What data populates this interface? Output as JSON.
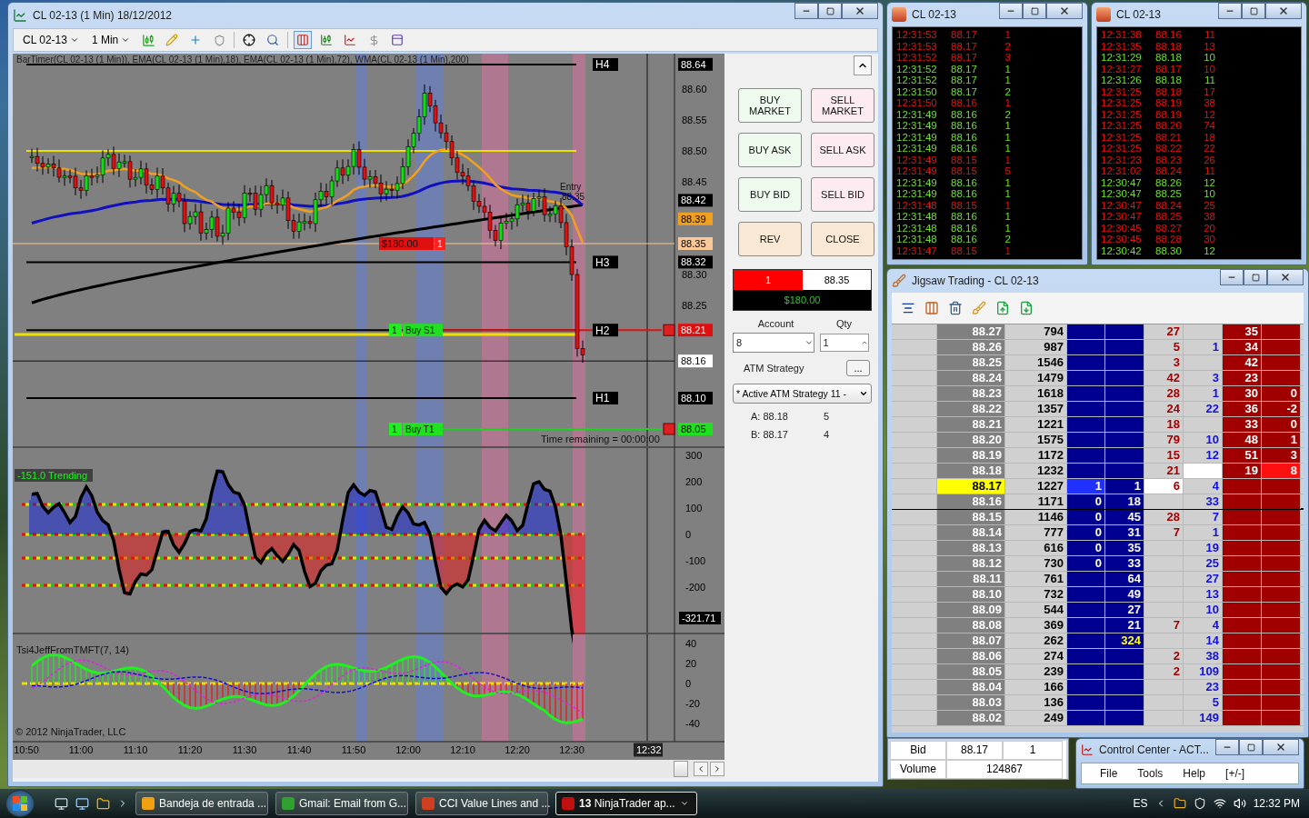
{
  "chart_window": {
    "title": "CL 02-13 (1 Min)  18/12/2012",
    "toolbar": {
      "instrument": "CL 02-13",
      "interval": "1 Min"
    },
    "chart": {
      "caption": "BarTimer(CL 02-13 (1 Min)), EMA(CL 02-13 (1 Min),18), EMA(CL 02-13 (1 Min),72), WMA(CL 02-13 (1 Min),200)",
      "price_axis": [
        {
          "text": "88.64",
          "kind": "boxed",
          "color": "#000000"
        },
        {
          "text": "88.60",
          "kind": "plain"
        },
        {
          "text": "88.55",
          "kind": "plain"
        },
        {
          "text": "88.50",
          "kind": "plain"
        },
        {
          "text": "88.45",
          "kind": "plain"
        },
        {
          "text": "88.42",
          "kind": "boxed",
          "color": "#000000"
        },
        {
          "text": "88.39",
          "kind": "boxed",
          "color": "#f0a020"
        },
        {
          "text": "88.35",
          "kind": "boxed",
          "color": "#f8c898"
        },
        {
          "text": "88.32",
          "kind": "boxed",
          "color": "#000000"
        },
        {
          "text": "88.30",
          "kind": "plain"
        },
        {
          "text": "88.25",
          "kind": "plain"
        },
        {
          "text": "88.21",
          "kind": "boxed",
          "color": "#e01010"
        },
        {
          "text": "88.16",
          "kind": "boxed",
          "color": "#ffffff"
        },
        {
          "text": "88.10",
          "kind": "boxed",
          "color": "#000000"
        },
        {
          "text": "88.05",
          "kind": "boxed",
          "color": "#20e020"
        }
      ],
      "levels": [
        {
          "label": "H4"
        },
        {
          "label": "H3"
        },
        {
          "label": "H2"
        },
        {
          "label": "H1"
        }
      ],
      "entry": {
        "label": "Entry",
        "price": "88.35"
      },
      "position": {
        "pnl": "$180.00",
        "qty": "1"
      },
      "orders": [
        {
          "qty": "1",
          "label": "Buy S1"
        },
        {
          "qty": "1",
          "label": "Buy T1"
        }
      ],
      "bar_timer": "Time remaining = 00:00:00",
      "oscillator": {
        "caption": "-151.0 Trending",
        "axis": [
          "300",
          "200",
          "100",
          "0",
          "-100",
          "-200"
        ],
        "value": "-321.71"
      },
      "tsi": {
        "caption": "Tsi4JeffFromTMFT(7, 14)",
        "axis": [
          "40",
          "20",
          "0",
          "-20",
          "-40"
        ]
      },
      "copyright": "© 2012 NinjaTrader, LLC",
      "time_axis": [
        "10:50",
        "11:00",
        "11:10",
        "11:20",
        "11:30",
        "11:40",
        "11:50",
        "12:00",
        "12:10",
        "12:20",
        "12:30"
      ],
      "cursor_time": "12:32"
    },
    "order_panel": {
      "buttons": [
        {
          "label": "BUY MARKET",
          "kind": "buy"
        },
        {
          "label": "SELL MARKET",
          "kind": "sell"
        },
        {
          "label": "BUY ASK",
          "kind": "buy"
        },
        {
          "label": "SELL ASK",
          "kind": "sell"
        },
        {
          "label": "BUY BID",
          "kind": "buy"
        },
        {
          "label": "SELL BID",
          "kind": "sell"
        },
        {
          "label": "REV",
          "kind": "neutral"
        },
        {
          "label": "CLOSE",
          "kind": "neutral"
        }
      ],
      "position": {
        "qty": "1",
        "avg_price": "88.35",
        "pnl": "$180.00"
      },
      "account_label": "Account",
      "account": "8",
      "qty_label": "Qty",
      "qty": "1",
      "atm_label": "ATM Strategy",
      "atm_button": "...",
      "atm_strategy": "* Active ATM Strategy 11 -",
      "quotes": [
        {
          "label": "A: 88.18",
          "size": "5"
        },
        {
          "label": "B: 88.17",
          "size": "4"
        }
      ]
    }
  },
  "time_and_sales": [
    {
      "title": "CL 02-13",
      "trades": [
        {
          "time": "12:31:53",
          "price": "88.17",
          "size": "1",
          "color": "#e81010"
        },
        {
          "time": "12:31:53",
          "price": "88.17",
          "size": "2",
          "color": "#e81010"
        },
        {
          "time": "12:31:52",
          "price": "88.17",
          "size": "3",
          "color": "#e81010"
        },
        {
          "time": "12:31:52",
          "price": "88.17",
          "size": "1",
          "color": "#70e020"
        },
        {
          "time": "12:31:52",
          "price": "88.17",
          "size": "1",
          "color": "#70e020"
        },
        {
          "time": "12:31:50",
          "price": "88.17",
          "size": "2",
          "color": "#70e020"
        },
        {
          "time": "12:31:50",
          "price": "88.16",
          "size": "1",
          "color": "#e81010"
        },
        {
          "time": "12:31:49",
          "price": "88.16",
          "size": "2",
          "color": "#70e020"
        },
        {
          "time": "12:31:49",
          "price": "88.16",
          "size": "1",
          "color": "#70e020"
        },
        {
          "time": "12:31:49",
          "price": "88.16",
          "size": "1",
          "color": "#70e020"
        },
        {
          "time": "12:31:49",
          "price": "88.16",
          "size": "1",
          "color": "#70e020"
        },
        {
          "time": "12:31:49",
          "price": "88.15",
          "size": "1",
          "color": "#e81010"
        },
        {
          "time": "12:31:49",
          "price": "88.15",
          "size": "5",
          "color": "#e81010"
        },
        {
          "time": "12:31:49",
          "price": "88.16",
          "size": "1",
          "color": "#70e020"
        },
        {
          "time": "12:31:49",
          "price": "88.16",
          "size": "1",
          "color": "#70e020"
        },
        {
          "time": "12:31:48",
          "price": "88.15",
          "size": "1",
          "color": "#e81010"
        },
        {
          "time": "12:31:48",
          "price": "88.16",
          "size": "1",
          "color": "#70e020"
        },
        {
          "time": "12:31:48",
          "price": "88.16",
          "size": "1",
          "color": "#70e020"
        },
        {
          "time": "12:31:48",
          "price": "88.16",
          "size": "2",
          "color": "#70e020"
        },
        {
          "time": "12:31:47",
          "price": "88.15",
          "size": "1",
          "color": "#e81010"
        }
      ]
    },
    {
      "title": "CL 02-13",
      "trades": [
        {
          "time": "12:31:38",
          "price": "88.16",
          "size": "11",
          "color": "#e81010"
        },
        {
          "time": "12:31:35",
          "price": "88.18",
          "size": "13",
          "color": "#e81010"
        },
        {
          "time": "12:31:29",
          "price": "88.18",
          "size": "10",
          "color": "#70e020"
        },
        {
          "time": "12:31:27",
          "price": "88.17",
          "size": "10",
          "color": "#e81010"
        },
        {
          "time": "12:31:26",
          "price": "88.18",
          "size": "11",
          "color": "#70e020"
        },
        {
          "time": "12:31:25",
          "price": "88.18",
          "size": "17",
          "color": "#e81010"
        },
        {
          "time": "12:31:25",
          "price": "88.19",
          "size": "38",
          "color": "#e81010"
        },
        {
          "time": "12:31:25",
          "price": "88.19",
          "size": "12",
          "color": "#e81010"
        },
        {
          "time": "12:31:25",
          "price": "88.20",
          "size": "74",
          "color": "#e81010"
        },
        {
          "time": "12:31:25",
          "price": "88.21",
          "size": "18",
          "color": "#e81010"
        },
        {
          "time": "12:31:25",
          "price": "88.22",
          "size": "22",
          "color": "#e81010"
        },
        {
          "time": "12:31:23",
          "price": "88.23",
          "size": "26",
          "color": "#e81010"
        },
        {
          "time": "12:31:02",
          "price": "88.24",
          "size": "11",
          "color": "#e81010"
        },
        {
          "time": "12:30:47",
          "price": "88.26",
          "size": "12",
          "color": "#70e020"
        },
        {
          "time": "12:30:47",
          "price": "88.25",
          "size": "10",
          "color": "#70e020"
        },
        {
          "time": "12:30:47",
          "price": "88.24",
          "size": "25",
          "color": "#e81010"
        },
        {
          "time": "12:30:47",
          "price": "88.25",
          "size": "38",
          "color": "#e81010"
        },
        {
          "time": "12:30:45",
          "price": "88.27",
          "size": "20",
          "color": "#e81010"
        },
        {
          "time": "12:30:45",
          "price": "88.28",
          "size": "30",
          "color": "#e81010"
        },
        {
          "time": "12:30:42",
          "price": "88.30",
          "size": "12",
          "color": "#70e020"
        }
      ]
    }
  ],
  "ladder_window": {
    "title": "Jigsaw Trading - CL 02-13",
    "rows": [
      {
        "price": "88.27",
        "volume": "794",
        "current": false,
        "split": false,
        "cells": [
          null,
          null,
          "27",
          null,
          "35",
          null
        ]
      },
      {
        "price": "88.26",
        "volume": "987",
        "current": false,
        "split": false,
        "cells": [
          null,
          null,
          "5",
          "1",
          "34",
          null
        ]
      },
      {
        "price": "88.25",
        "volume": "1546",
        "current": false,
        "split": false,
        "cells": [
          null,
          null,
          "3",
          null,
          "42",
          null
        ]
      },
      {
        "price": "88.24",
        "volume": "1479",
        "current": false,
        "split": false,
        "cells": [
          null,
          null,
          "42",
          "3",
          "23",
          null
        ]
      },
      {
        "price": "88.23",
        "volume": "1618",
        "current": false,
        "split": false,
        "cells": [
          null,
          null,
          "28",
          "1",
          "30",
          "0"
        ]
      },
      {
        "price": "88.22",
        "volume": "1357",
        "current": false,
        "split": false,
        "cells": [
          null,
          null,
          "24",
          "22",
          "36",
          "-2"
        ]
      },
      {
        "price": "88.21",
        "volume": "1221",
        "current": false,
        "split": false,
        "cells": [
          null,
          null,
          "18",
          null,
          "33",
          "0"
        ]
      },
      {
        "price": "88.20",
        "volume": "1575",
        "current": false,
        "split": false,
        "cells": [
          null,
          null,
          "79",
          "10",
          "48",
          "1"
        ]
      },
      {
        "price": "88.19",
        "volume": "1172",
        "current": false,
        "split": false,
        "cells": [
          null,
          null,
          "15",
          "12",
          "51",
          "3"
        ]
      },
      {
        "price": "88.18",
        "volume": "1232",
        "current": false,
        "split": false,
        "cells": [
          null,
          null,
          "21",
          {
            "highlight": true
          },
          "19",
          {
            "text": "8",
            "highlight": true
          }
        ]
      },
      {
        "price": "88.17",
        "volume": "1227",
        "current": true,
        "split": false,
        "cells": [
          {
            "text": "1",
            "highlight": true
          },
          "1",
          {
            "text": "6",
            "highlight": true
          },
          "4",
          null,
          null
        ]
      },
      {
        "price": "88.16",
        "volume": "1171",
        "current": false,
        "split": true,
        "cells": [
          "0",
          "18",
          null,
          "33",
          null,
          null
        ]
      },
      {
        "price": "88.15",
        "volume": "1146",
        "current": false,
        "split": false,
        "cells": [
          "0",
          "45",
          "28",
          "7",
          null,
          null
        ]
      },
      {
        "price": "88.14",
        "volume": "777",
        "current": false,
        "split": false,
        "cells": [
          "0",
          "31",
          "7",
          "1",
          null,
          null
        ]
      },
      {
        "price": "88.13",
        "volume": "616",
        "current": false,
        "split": false,
        "cells": [
          "0",
          "35",
          null,
          "19",
          null,
          null
        ]
      },
      {
        "price": "88.12",
        "volume": "730",
        "current": false,
        "split": false,
        "cells": [
          "0",
          "33",
          null,
          "25",
          null,
          null
        ]
      },
      {
        "price": "88.11",
        "volume": "761",
        "current": false,
        "split": false,
        "cells": [
          null,
          "64",
          null,
          "27",
          null,
          null
        ]
      },
      {
        "price": "88.10",
        "volume": "732",
        "current": false,
        "split": false,
        "cells": [
          null,
          "49",
          null,
          "13",
          null,
          null
        ]
      },
      {
        "price": "88.09",
        "volume": "544",
        "current": false,
        "split": false,
        "cells": [
          null,
          "27",
          null,
          "10",
          null,
          null
        ]
      },
      {
        "price": "88.08",
        "volume": "369",
        "current": false,
        "split": false,
        "cells": [
          null,
          "21",
          "7",
          "4",
          null,
          null
        ]
      },
      {
        "price": "88.07",
        "volume": "262",
        "current": false,
        "split": false,
        "cells": [
          null,
          {
            "text": "324",
            "highlight": true
          },
          null,
          "14",
          null,
          null
        ]
      },
      {
        "price": "88.06",
        "volume": "274",
        "current": false,
        "split": false,
        "cells": [
          null,
          null,
          "2",
          "38",
          null,
          null
        ]
      },
      {
        "price": "88.05",
        "volume": "239",
        "current": false,
        "split": false,
        "cells": [
          null,
          null,
          "2",
          "109",
          null,
          null
        ]
      },
      {
        "price": "88.04",
        "volume": "166",
        "current": false,
        "split": false,
        "cells": [
          null,
          null,
          null,
          "23",
          null,
          null
        ]
      },
      {
        "price": "88.03",
        "volume": "136",
        "current": false,
        "split": false,
        "cells": [
          null,
          null,
          null,
          "5",
          null,
          null
        ]
      },
      {
        "price": "88.02",
        "volume": "249",
        "current": false,
        "split": false,
        "cells": [
          null,
          null,
          null,
          "149",
          null,
          null
        ]
      }
    ]
  },
  "quote_box": {
    "bid_label": "Bid",
    "bid_price": "88.17",
    "bid_size": "1",
    "volume_label": "Volume",
    "volume": "124867"
  },
  "control_center": {
    "title": "Control Center - ACT...",
    "menu": [
      "File",
      "Tools",
      "Help",
      "[+/-]"
    ]
  },
  "taskbar": {
    "tasks": [
      {
        "label": "Bandeja de entrada ...",
        "kind": "mail",
        "active": false
      },
      {
        "label": "Gmail: Email from G...",
        "kind": "browser",
        "active": false
      },
      {
        "label": "CCI Value Lines and ...",
        "kind": "slides",
        "active": false
      },
      {
        "label": "**13** NinjaTrader ap...",
        "kind": "app",
        "active": true
      }
    ],
    "language": "ES",
    "clock": "12:32 PM"
  }
}
